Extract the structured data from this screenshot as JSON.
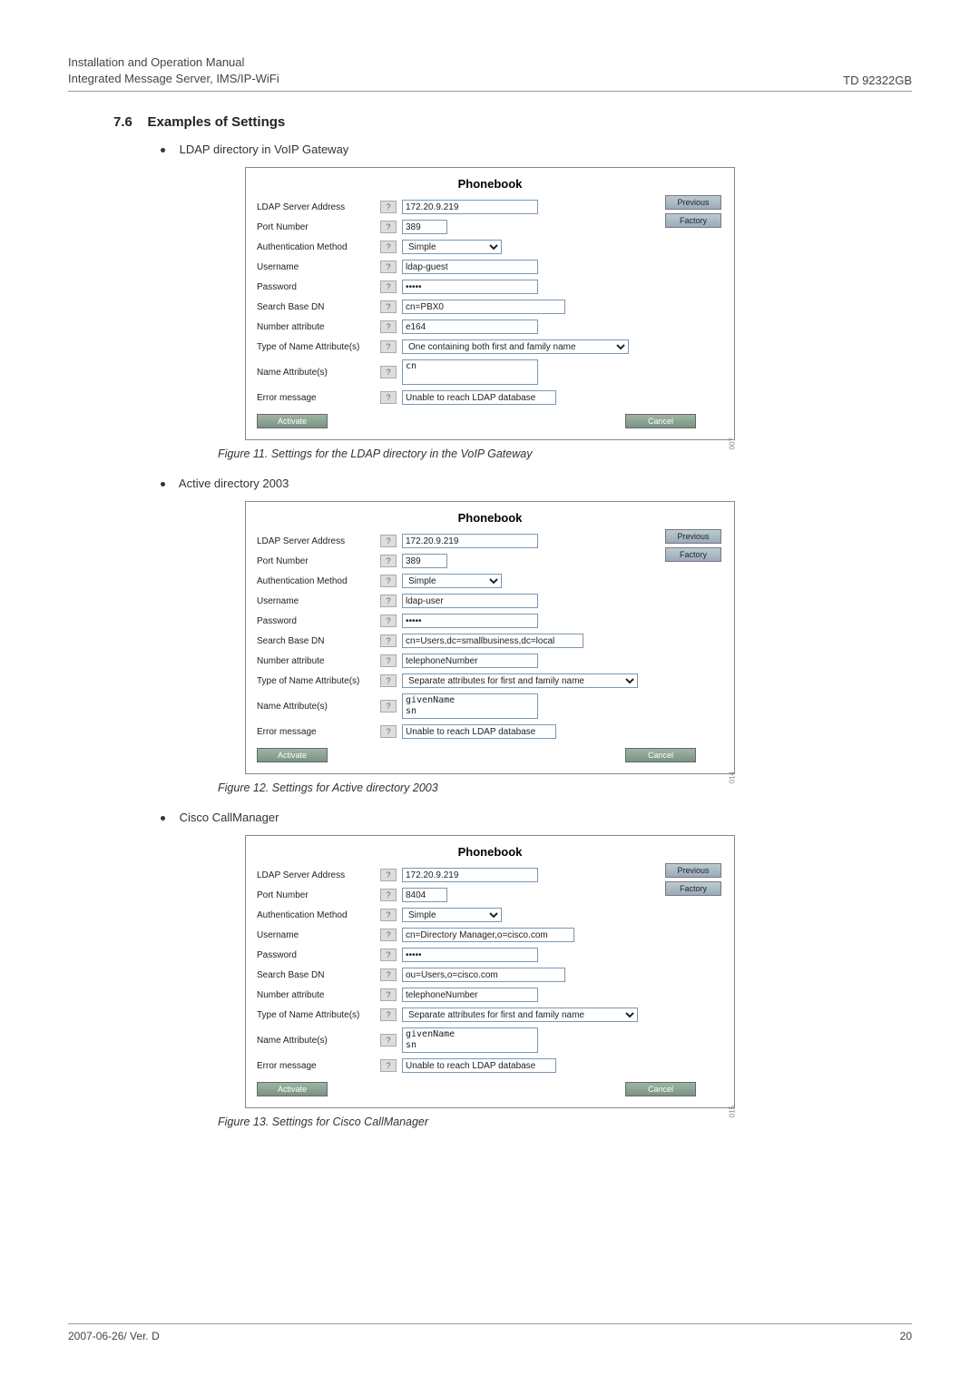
{
  "header": {
    "line1": "Installation and Operation Manual",
    "line2": "Integrated Message Server, IMS/IP-WiFi",
    "td": "TD 92322GB"
  },
  "section": {
    "number": "7.6",
    "title": "Examples of Settings",
    "bullet1": "LDAP directory in VoIP Gateway",
    "bullet2": "Active directory 2003",
    "bullet3": "Cisco CallManager"
  },
  "captions": {
    "c1": "Figure 11. Settings for the LDAP directory in the VoIP Gateway",
    "c2": "Figure 12. Settings for Active directory 2003",
    "c3": "Figure 13. Settings for Cisco CallManager"
  },
  "labels": {
    "phonebook": "Phonebook",
    "ldap_server": "LDAP Server Address",
    "port": "Port Number",
    "auth": "Authentication Method",
    "username": "Username",
    "password": "Password",
    "search_base": "Search Base DN",
    "number_attr": "Number attribute",
    "type_name_attr": "Type of Name Attribute(s)",
    "name_attr": "Name Attribute(s)",
    "error_msg": "Error message",
    "previous": "Previous",
    "factory": "Factory",
    "activate": "Activate",
    "cancel": "Cancel",
    "help": "?"
  },
  "pb1": {
    "ldap_server": "172.20.9.219",
    "port": "389",
    "auth": "Simple",
    "username": "ldap-guest",
    "password": "•••••",
    "search_base": "cn=PBX0",
    "number_attr": "e164",
    "type_name_attr": "One containing both first and family name",
    "name_attr": "cn",
    "error_msg": "Unable to reach LDAP database",
    "code": "007"
  },
  "pb2": {
    "ldap_server": "172.20.9.219",
    "port": "389",
    "auth": "Simple",
    "username": "ldap-user",
    "password": "•••••",
    "search_base": "cn=Users,dc=smallbusiness,dc=local",
    "number_attr": "telephoneNumber",
    "type_name_attr": "Separate attributes for first and family name",
    "name_attr": "givenName\nsn",
    "error_msg": "Unable to reach LDAP database",
    "code": "014"
  },
  "pb3": {
    "ldap_server": "172.20.9.219",
    "port": "8404",
    "auth": "Simple",
    "username": "cn=Directory Manager,o=cisco.com",
    "password": "•••••",
    "search_base": "ou=Users,o=cisco.com",
    "number_attr": "telephoneNumber",
    "type_name_attr": "Separate attributes for first and family name",
    "name_attr": "givenName\nsn",
    "error_msg": "Unable to reach LDAP database",
    "code": "015"
  },
  "footer": {
    "left": "2007-06-26/ Ver. D",
    "right": "20"
  }
}
